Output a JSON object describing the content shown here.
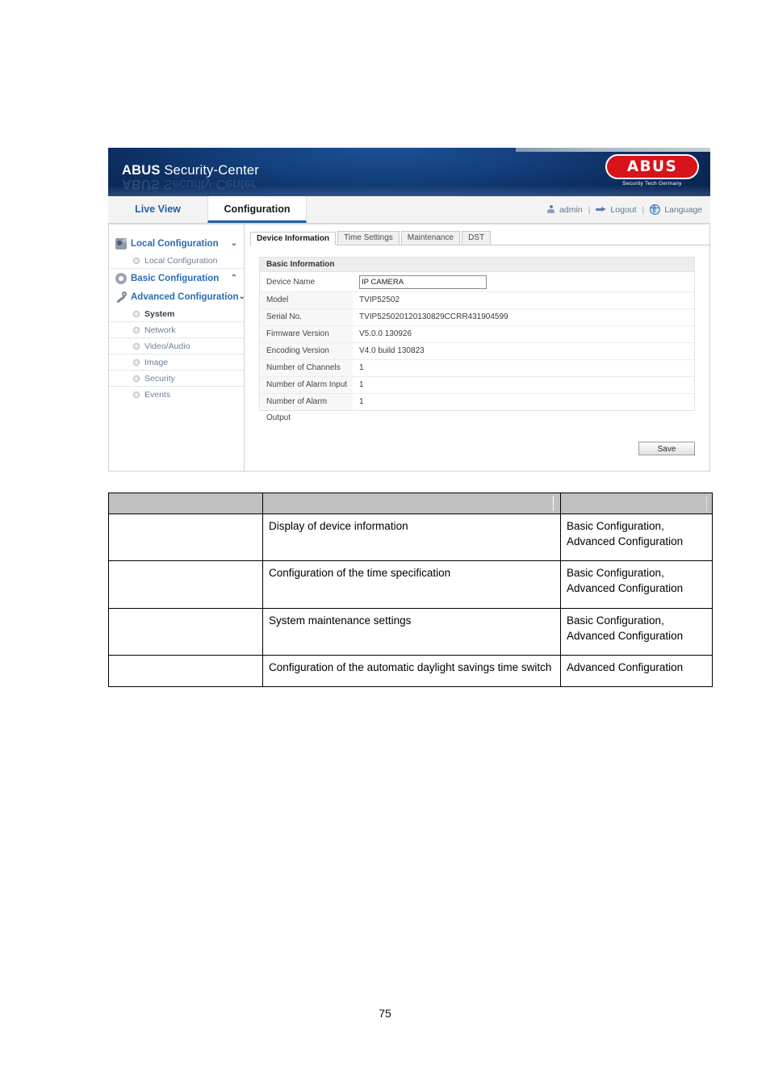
{
  "app": {
    "brand_bold": "ABUS",
    "brand_light": " Security-Center",
    "logo_text": "ABUS",
    "logo_sub": "Security Tech Germany",
    "accent_blue": "#1f5fa8",
    "header_blue": "#0d2f63",
    "logo_red": "#d8131a"
  },
  "nav": {
    "tabs": [
      {
        "label": "Live View",
        "active": false
      },
      {
        "label": "Configuration",
        "active": true
      }
    ],
    "user": {
      "name": "admin",
      "logout": "Logout",
      "language": "Language",
      "separator": "|"
    }
  },
  "sidebar": {
    "groups": [
      {
        "label": "Local Configuration",
        "icon": "camera-icon",
        "chevron": "⌄",
        "items": [
          {
            "label": "Local Configuration",
            "selected": false
          }
        ]
      },
      {
        "label": "Basic Configuration",
        "icon": "gear-icon",
        "chevron": "⌃",
        "items": []
      },
      {
        "label": "Advanced Configuration",
        "icon": "wrench-icon",
        "chevron": "⌄",
        "items": [
          {
            "label": "System",
            "selected": true
          },
          {
            "label": "Network",
            "selected": false
          },
          {
            "label": "Video/Audio",
            "selected": false
          },
          {
            "label": "Image",
            "selected": false
          },
          {
            "label": "Security",
            "selected": false
          },
          {
            "label": "Events",
            "selected": false
          }
        ]
      }
    ]
  },
  "content": {
    "tabs": [
      {
        "label": "Device Information",
        "active": true
      },
      {
        "label": "Time Settings",
        "active": false
      },
      {
        "label": "Maintenance",
        "active": false
      },
      {
        "label": "DST",
        "active": false
      }
    ],
    "panel_title": "Basic Information",
    "device_name": {
      "label": "Device Name",
      "value": "IP CAMERA"
    },
    "info_rows": [
      {
        "key": "Model",
        "value": "TVIP52502"
      },
      {
        "key": "Serial No.",
        "value": "TVIP525020120130829CCRR431904599"
      },
      {
        "key": "Firmware Version",
        "value": "V5.0.0 130926"
      },
      {
        "key": "Encoding Version",
        "value": "V4.0 build 130823"
      },
      {
        "key": "Number of Channels",
        "value": "1"
      },
      {
        "key": "Number of Alarm Input",
        "value": "1"
      },
      {
        "key": "Number of Alarm Output",
        "value": "1"
      }
    ],
    "save_label": "Save"
  },
  "desc_table": {
    "header": [
      "",
      "",
      ""
    ],
    "rows": [
      {
        "c1": "",
        "c2": "Display of device information",
        "c3": "Basic Configuration, Advanced Configuration"
      },
      {
        "c1": "",
        "c2": "Configuration of the time specification",
        "c3": "Basic Configuration, Advanced Configuration"
      },
      {
        "c1": "",
        "c2": "System maintenance settings",
        "c3": "Basic Configuration, Advanced Configuration"
      },
      {
        "c1": "",
        "c2": "Configuration of the automatic daylight savings time switch",
        "c3": "Advanced Configuration"
      }
    ]
  },
  "page": {
    "number": "75"
  }
}
